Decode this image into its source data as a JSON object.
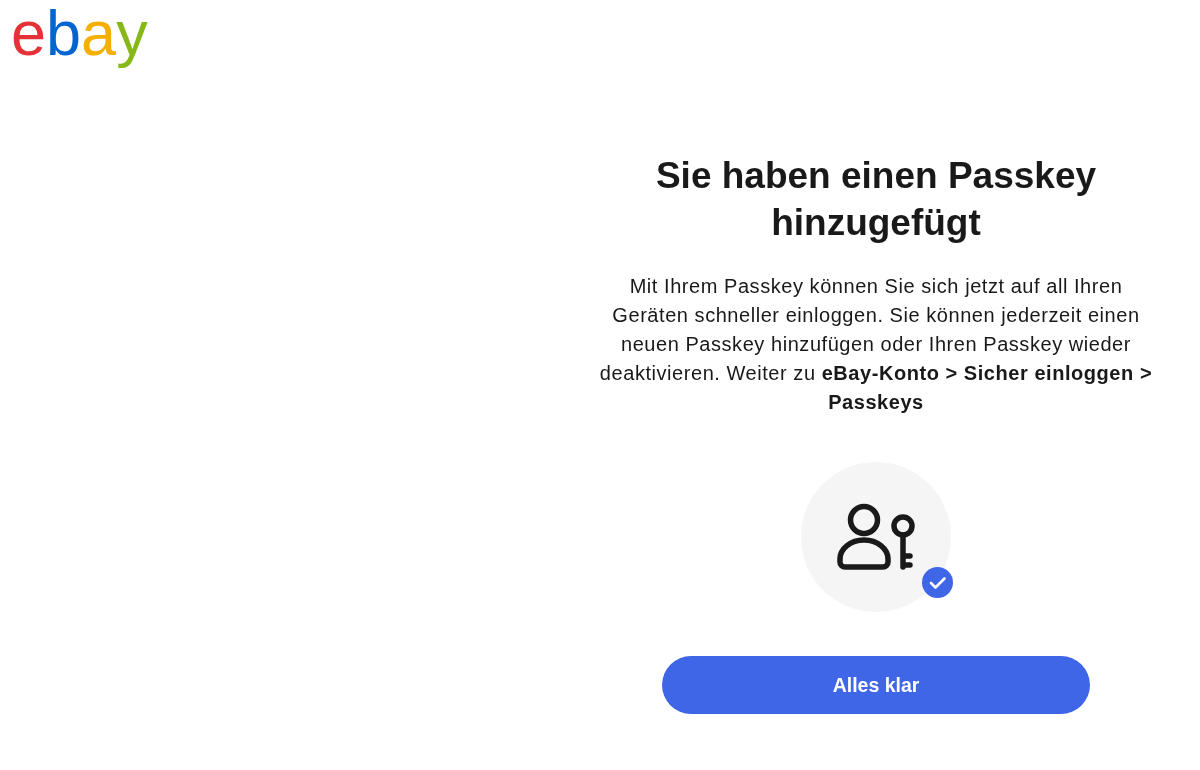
{
  "logo": {
    "text": "ebay"
  },
  "dialog": {
    "title": "Sie haben einen Passkey hinzugefügt",
    "message": "Mit Ihrem Passkey können Sie sich jetzt auf all Ihren Geräten schneller einloggen. Sie können jederzeit einen neuen Passkey hinzufügen oder Ihren Passkey wieder deaktivieren. Weiter zu **eBay-Konto > Sicher einloggen > Passkeys**",
    "button": {
      "label": "Alles klar"
    }
  }
}
